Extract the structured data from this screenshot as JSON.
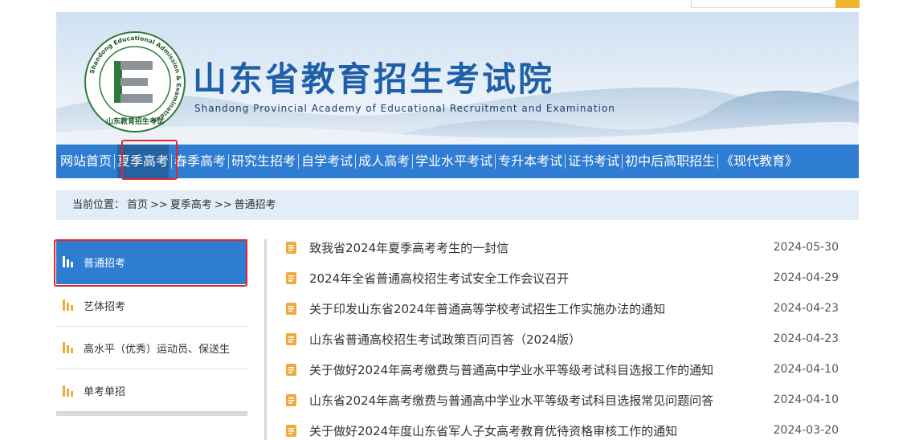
{
  "banner": {
    "title_cn": "山东省教育招生考试院",
    "title_en": "Shandong Provincial Academy of Educational Recruitment and Examination",
    "logo_ring_text": "Shandong Educational Admission & Examinations",
    "logo_bottom_text": "山东教育招生考试",
    "logo_letter": "E"
  },
  "nav": {
    "items": [
      "网站首页",
      "夏季高考",
      "春季高考",
      "研究生招考",
      "自学考试",
      "成人高考",
      "学业水平考试",
      "专升本考试",
      "证书考试",
      "初中后高职招生",
      "《现代教育》"
    ],
    "active_index": 1
  },
  "breadcrumb": {
    "prefix": "当前位置：",
    "items": [
      "首页",
      "夏季高考",
      "普通招考"
    ],
    "separator": ">>"
  },
  "sidebar": {
    "items": [
      "普通招考",
      "艺体招考",
      "高水平（优秀）运动员、保送生",
      "单考单招"
    ],
    "active_index": 0
  },
  "news": [
    {
      "title": "致我省2024年夏季高考考生的一封信",
      "date": "2024-05-30"
    },
    {
      "title": "2024年全省普通高校招生考试安全工作会议召开",
      "date": "2024-04-29"
    },
    {
      "title": "关于印发山东省2024年普通高等学校考试招生工作实施办法的通知",
      "date": "2024-04-23"
    },
    {
      "title": "山东省普通高校招生考试政策百问百答（2024版）",
      "date": "2024-04-23"
    },
    {
      "title": "关于做好2024年高考缴费与普通高中学业水平等级考试科目选报工作的通知",
      "date": "2024-04-10"
    },
    {
      "title": "山东省2024年高考缴费与普通高中学业水平等级考试科目选报常见问题问答",
      "date": "2024-04-10"
    },
    {
      "title": "关于做好2024年度山东省军人子女高考教育优待资格审核工作的通知",
      "date": "2024-03-20"
    }
  ],
  "colors": {
    "nav_blue": "#2f7cd3",
    "highlight_red": "#e3262c",
    "icon_orange": "#f0a93a",
    "crumb_bg": "#e2edf8"
  },
  "icons": {
    "search": "search-icon",
    "sidebar": "bar-chart-icon",
    "news": "document-icon"
  }
}
